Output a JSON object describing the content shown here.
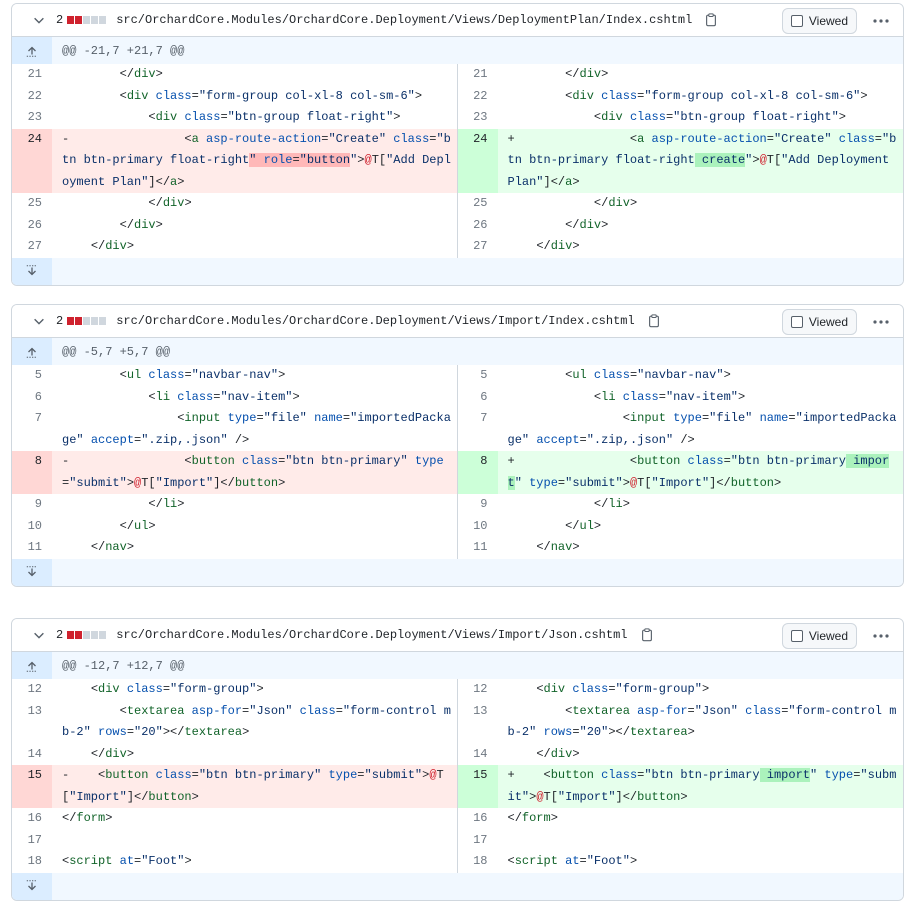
{
  "colors": {
    "deleted": "#cf222e",
    "added": "#1a7f37",
    "neutral": "#d0d7de"
  },
  "viewed_label": "Viewed",
  "files": [
    {
      "count": "2",
      "path": "src/OrchardCore.Modules/OrchardCore.Deployment/Views/DeploymentPlan/Index.cshtml",
      "hunk": "@@ -21,7 +21,7 @@",
      "left": [
        {
          "n": "21",
          "t": "ctx",
          "html": "        &lt;/<span class='tag'>div</span>&gt;"
        },
        {
          "n": "22",
          "t": "ctx",
          "html": "        &lt;<span class='tag'>div</span> <span class='attr'>class</span>=<span class='str'>\"form-group col-xl-8 col-sm-6\"</span>&gt;"
        },
        {
          "n": "23",
          "t": "ctx",
          "html": "            &lt;<span class='tag'>div</span> <span class='attr'>class</span>=<span class='str'>\"btn-group float-right\"</span>&gt;"
        },
        {
          "n": "24",
          "t": "del",
          "html": "-                &lt;<span class='tag'>a</span> <span class='attr'>asp-route-action</span>=<span class='str'>\"Create\"</span> <span class='attr'>class</span>=<span class='str'>\"btn btn-primary float-right<span class='hl-del'>\" </span></span><span class='hl-del'><span class='attr'>role</span>=<span class='str'>\"button</span></span><span class='str'>\"</span>&gt;<span class='at'>@</span>T[<span class='str'>\"Add Deployment Plan\"</span>]&lt;/<span class='tag'>a</span>&gt;"
        },
        {
          "n": "25",
          "t": "ctx",
          "html": "            &lt;/<span class='tag'>div</span>&gt;"
        },
        {
          "n": "26",
          "t": "ctx",
          "html": "        &lt;/<span class='tag'>div</span>&gt;"
        },
        {
          "n": "27",
          "t": "ctx",
          "html": "    &lt;/<span class='tag'>div</span>&gt;"
        }
      ],
      "right": [
        {
          "n": "21",
          "t": "ctx",
          "html": "        &lt;/<span class='tag'>div</span>&gt;"
        },
        {
          "n": "22",
          "t": "ctx",
          "html": "        &lt;<span class='tag'>div</span> <span class='attr'>class</span>=<span class='str'>\"form-group col-xl-8 col-sm-6\"</span>&gt;"
        },
        {
          "n": "23",
          "t": "ctx",
          "html": "            &lt;<span class='tag'>div</span> <span class='attr'>class</span>=<span class='str'>\"btn-group float-right\"</span>&gt;"
        },
        {
          "n": "24",
          "t": "add",
          "html": "+                &lt;<span class='tag'>a</span> <span class='attr'>asp-route-action</span>=<span class='str'>\"Create\"</span> <span class='attr'>class</span>=<span class='str'>\"btn btn-primary float-right<span class='hl-add'> create</span>\"</span>&gt;<span class='at'>@</span>T[<span class='str'>\"Add Deployment Plan\"</span>]&lt;/<span class='tag'>a</span>&gt;"
        },
        {
          "n": "25",
          "t": "ctx",
          "html": "            &lt;/<span class='tag'>div</span>&gt;"
        },
        {
          "n": "26",
          "t": "ctx",
          "html": "        &lt;/<span class='tag'>div</span>&gt;"
        },
        {
          "n": "27",
          "t": "ctx",
          "html": "    &lt;/<span class='tag'>div</span>&gt;"
        }
      ]
    },
    {
      "count": "2",
      "path": "src/OrchardCore.Modules/OrchardCore.Deployment/Views/Import/Index.cshtml",
      "hunk": "@@ -5,7 +5,7 @@",
      "left": [
        {
          "n": "5",
          "t": "ctx",
          "html": "        &lt;<span class='tag'>ul</span> <span class='attr'>class</span>=<span class='str'>\"navbar-nav\"</span>&gt;"
        },
        {
          "n": "6",
          "t": "ctx",
          "html": "            &lt;<span class='tag'>li</span> <span class='attr'>class</span>=<span class='str'>\"nav-item\"</span>&gt;"
        },
        {
          "n": "7",
          "t": "ctx",
          "html": "                &lt;<span class='tag'>input</span> <span class='attr'>type</span>=<span class='str'>\"file\"</span> <span class='attr'>name</span>=<span class='str'>\"importedPackage\"</span> <span class='attr'>accept</span>=<span class='str'>\".zip,.json\"</span> /&gt;"
        },
        {
          "n": "8",
          "t": "del",
          "html": "-                &lt;<span class='tag'>button</span> <span class='attr'>class</span>=<span class='str'>\"btn btn-primary\"</span> <span class='attr'>type</span>=<span class='str'>\"submit\"</span>&gt;<span class='at'>@</span>T[<span class='str'>\"Import\"</span>]&lt;/<span class='tag'>button</span>&gt;"
        },
        {
          "n": "9",
          "t": "ctx",
          "html": "            &lt;/<span class='tag'>li</span>&gt;"
        },
        {
          "n": "10",
          "t": "ctx",
          "html": "        &lt;/<span class='tag'>ul</span>&gt;"
        },
        {
          "n": "11",
          "t": "ctx",
          "html": "    &lt;/<span class='tag'>nav</span>&gt;"
        }
      ],
      "right": [
        {
          "n": "5",
          "t": "ctx",
          "html": "        &lt;<span class='tag'>ul</span> <span class='attr'>class</span>=<span class='str'>\"navbar-nav\"</span>&gt;"
        },
        {
          "n": "6",
          "t": "ctx",
          "html": "            &lt;<span class='tag'>li</span> <span class='attr'>class</span>=<span class='str'>\"nav-item\"</span>&gt;"
        },
        {
          "n": "7",
          "t": "ctx",
          "html": "                &lt;<span class='tag'>input</span> <span class='attr'>type</span>=<span class='str'>\"file\"</span> <span class='attr'>name</span>=<span class='str'>\"importedPackage\"</span> <span class='attr'>accept</span>=<span class='str'>\".zip,.json\"</span> /&gt;"
        },
        {
          "n": "8",
          "t": "add",
          "html": "+                &lt;<span class='tag'>button</span> <span class='attr'>class</span>=<span class='str'>\"btn btn-primary<span class='hl-add'> import</span>\"</span> <span class='attr'>type</span>=<span class='str'>\"submit\"</span>&gt;<span class='at'>@</span>T[<span class='str'>\"Import\"</span>]&lt;/<span class='tag'>button</span>&gt;"
        },
        {
          "n": "9",
          "t": "ctx",
          "html": "            &lt;/<span class='tag'>li</span>&gt;"
        },
        {
          "n": "10",
          "t": "ctx",
          "html": "        &lt;/<span class='tag'>ul</span>&gt;"
        },
        {
          "n": "11",
          "t": "ctx",
          "html": "    &lt;/<span class='tag'>nav</span>&gt;"
        }
      ]
    },
    {
      "count": "2",
      "path": "src/OrchardCore.Modules/OrchardCore.Deployment/Views/Import/Json.cshtml",
      "hunk": "@@ -12,7 +12,7 @@",
      "left": [
        {
          "n": "12",
          "t": "ctx",
          "html": "    &lt;<span class='tag'>div</span> <span class='attr'>class</span>=<span class='str'>\"form-group\"</span>&gt;"
        },
        {
          "n": "13",
          "t": "ctx",
          "html": "        &lt;<span class='tag'>textarea</span> <span class='attr'>asp-for</span>=<span class='str'>\"Json\"</span> <span class='attr'>class</span>=<span class='str'>\"form-control mb-2\"</span> <span class='attr'>rows</span>=<span class='str'>\"20\"</span>&gt;&lt;/<span class='tag'>textarea</span>&gt;"
        },
        {
          "n": "14",
          "t": "ctx",
          "html": "    &lt;/<span class='tag'>div</span>&gt;"
        },
        {
          "n": "15",
          "t": "del",
          "html": "-    &lt;<span class='tag'>button</span> <span class='attr'>class</span>=<span class='str'>\"btn btn-primary\"</span> <span class='attr'>type</span>=<span class='str'>\"submit\"</span>&gt;<span class='at'>@</span>T[<span class='str'>\"Import\"</span>]&lt;/<span class='tag'>button</span>&gt;"
        },
        {
          "n": "16",
          "t": "ctx",
          "html": "&lt;/<span class='tag'>form</span>&gt;"
        },
        {
          "n": "17",
          "t": "ctx",
          "html": ""
        },
        {
          "n": "18",
          "t": "ctx",
          "html": "&lt;<span class='tag'>script</span> <span class='attr'>at</span>=<span class='str'>\"Foot\"</span>&gt;"
        }
      ],
      "right": [
        {
          "n": "12",
          "t": "ctx",
          "html": "    &lt;<span class='tag'>div</span> <span class='attr'>class</span>=<span class='str'>\"form-group\"</span>&gt;"
        },
        {
          "n": "13",
          "t": "ctx",
          "html": "        &lt;<span class='tag'>textarea</span> <span class='attr'>asp-for</span>=<span class='str'>\"Json\"</span> <span class='attr'>class</span>=<span class='str'>\"form-control mb-2\"</span> <span class='attr'>rows</span>=<span class='str'>\"20\"</span>&gt;&lt;/<span class='tag'>textarea</span>&gt;"
        },
        {
          "n": "14",
          "t": "ctx",
          "html": "    &lt;/<span class='tag'>div</span>&gt;"
        },
        {
          "n": "15",
          "t": "add",
          "html": "+    &lt;<span class='tag'>button</span> <span class='attr'>class</span>=<span class='str'>\"btn btn-primary<span class='hl-add'> import</span>\"</span> <span class='attr'>type</span>=<span class='str'>\"submit\"</span>&gt;<span class='at'>@</span>T[<span class='str'>\"Import\"</span>]&lt;/<span class='tag'>button</span>&gt;"
        },
        {
          "n": "16",
          "t": "ctx",
          "html": "&lt;/<span class='tag'>form</span>&gt;"
        },
        {
          "n": "17",
          "t": "ctx",
          "html": ""
        },
        {
          "n": "18",
          "t": "ctx",
          "html": "&lt;<span class='tag'>script</span> <span class='attr'>at</span>=<span class='str'>\"Foot\"</span>&gt;"
        }
      ]
    }
  ]
}
